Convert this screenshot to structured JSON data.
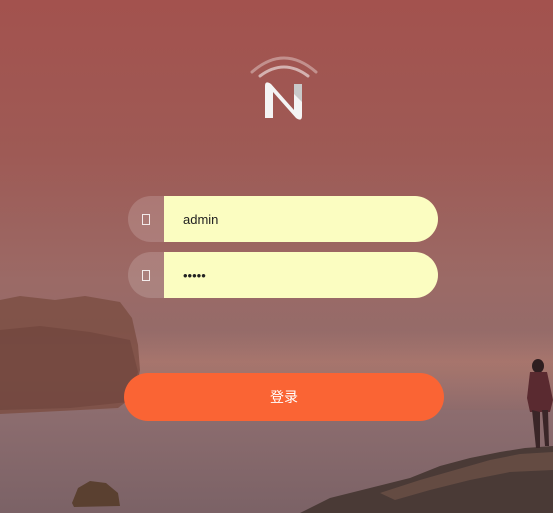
{
  "login": {
    "username_value": "admin",
    "password_value": "admin",
    "submit_label": "登录"
  },
  "colors": {
    "accent": "#fa6434",
    "input_bg": "#fbfdc1"
  },
  "icons": {
    "user_field": "user-icon",
    "password_field": "lock-icon",
    "logo": "wifi-n-logo"
  }
}
